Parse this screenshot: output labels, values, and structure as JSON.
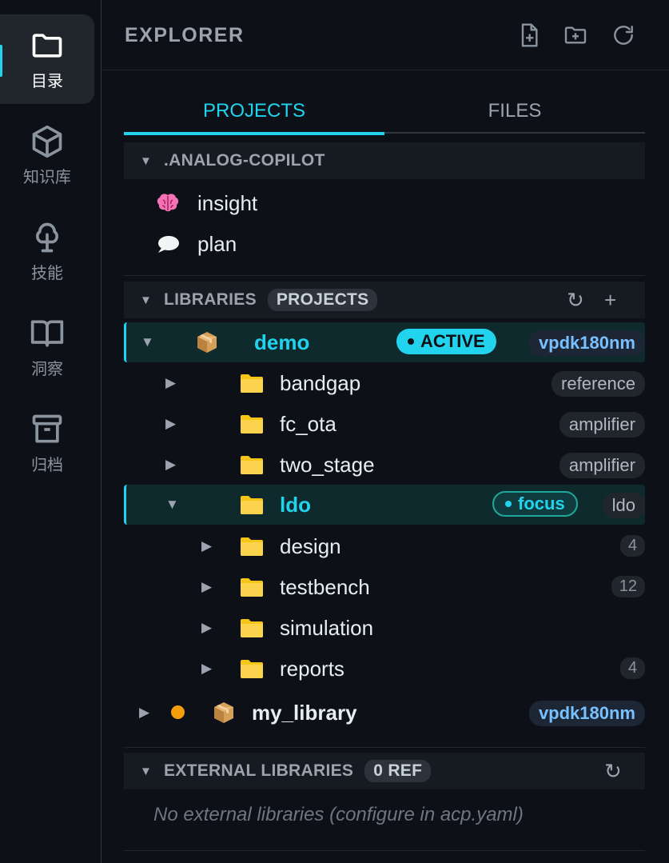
{
  "activity_bar": [
    {
      "label": "目录",
      "icon": "folder-icon",
      "active": true
    },
    {
      "label": "知识库",
      "icon": "cube-icon",
      "active": false
    },
    {
      "label": "技能",
      "icon": "tree-icon",
      "active": false
    },
    {
      "label": "洞察",
      "icon": "book-icon",
      "active": false
    },
    {
      "label": "归档",
      "icon": "archive-icon",
      "active": false
    }
  ],
  "header": {
    "title": "EXPLORER",
    "icons": [
      "new-file-icon",
      "new-folder-icon",
      "refresh-icon"
    ]
  },
  "tabs": [
    {
      "label": "PROJECTS",
      "active": true
    },
    {
      "label": "FILES",
      "active": false
    }
  ],
  "analog_copilot": {
    "title": ".ANALOG-COPILOT",
    "items": [
      {
        "label": "insight",
        "icon": "brain-icon"
      },
      {
        "label": "plan",
        "icon": "speech-bubble-icon"
      }
    ]
  },
  "libraries": {
    "title": "LIBRARIES",
    "pill": "PROJECTS",
    "refresh_glyph": "↻",
    "add_glyph": "+",
    "demo": {
      "label": "demo",
      "badge": "ACTIVE",
      "tag": "vpdk180nm",
      "children": [
        {
          "label": "bandgap",
          "tag": "reference"
        },
        {
          "label": "fc_ota",
          "tag": "amplifier"
        },
        {
          "label": "two_stage",
          "tag": "amplifier"
        }
      ],
      "ldo": {
        "label": "ldo",
        "badge": "focus",
        "tag": "ldo",
        "children": [
          {
            "label": "design",
            "count": "4"
          },
          {
            "label": "testbench",
            "count": "12"
          },
          {
            "label": "simulation",
            "count": ""
          },
          {
            "label": "reports",
            "count": "4"
          }
        ]
      }
    },
    "my_library": {
      "label": "my_library",
      "tag": "vpdk180nm",
      "status_color": "#f59e0b"
    }
  },
  "external": {
    "title": "EXTERNAL LIBRARIES",
    "pill": "0 REF",
    "refresh_glyph": "↻",
    "empty_text": "No external libraries (configure in acp.yaml)"
  },
  "colors": {
    "accent": "#22d3ee",
    "folder": "#f5c518",
    "background": "#0d1117"
  }
}
